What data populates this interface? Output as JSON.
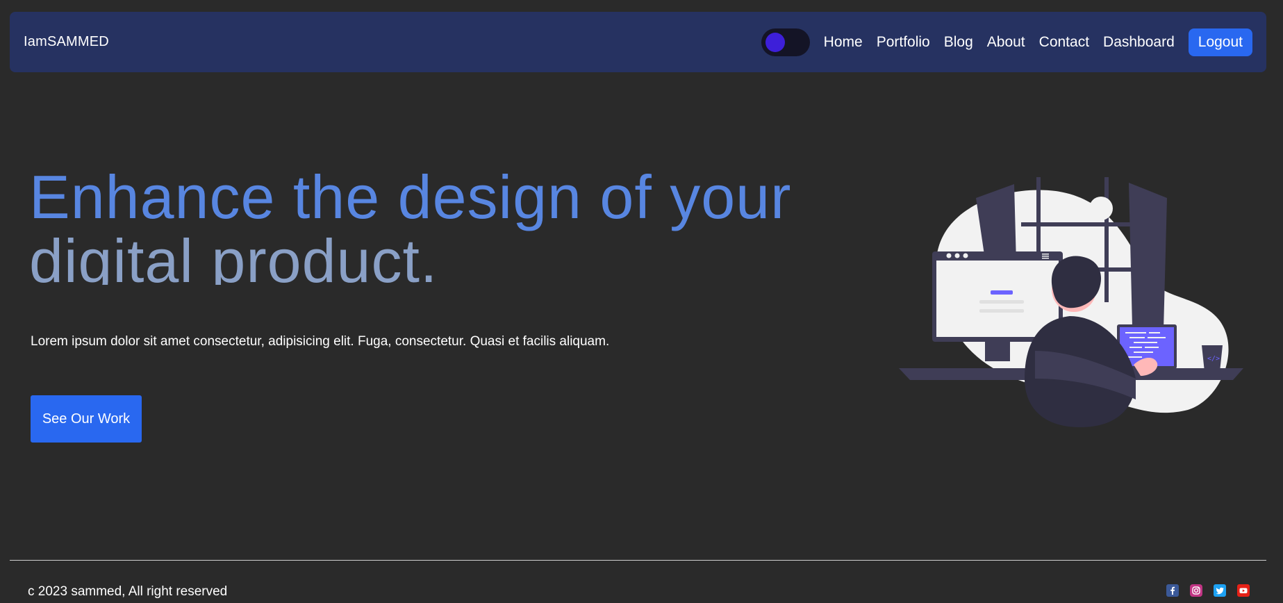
{
  "navbar": {
    "brand": "IamSAMMED",
    "theme_toggle": {
      "state": "dark",
      "knob_color": "#3d1fd9"
    },
    "links": [
      "Home",
      "Portfolio",
      "Blog",
      "About",
      "Contact",
      "Dashboard"
    ],
    "logout_label": "Logout"
  },
  "hero": {
    "title_line1": "Enhance the design of your",
    "title_line2": "digital product.",
    "description": "Lorem ipsum dolor sit amet consectetur, adipisicing elit. Fuga, consectetur. Quasi et facilis aliquam.",
    "cta_label": "See Our Work",
    "illustration": "person-at-computer-illustration"
  },
  "footer": {
    "copyright": "c 2023 sammed, All right reserved",
    "socials": [
      {
        "name": "facebook-icon",
        "color": "#3b5998"
      },
      {
        "name": "instagram-icon",
        "color": "#c13584"
      },
      {
        "name": "twitter-icon",
        "color": "#1da1f2"
      },
      {
        "name": "youtube-icon",
        "color": "#e62117"
      }
    ]
  },
  "colors": {
    "background": "#2a2a2a",
    "navbar": "#263261",
    "accent_blue": "#2968f0",
    "title_primary": "#5886e1",
    "title_secondary": "#8aa0c6"
  }
}
